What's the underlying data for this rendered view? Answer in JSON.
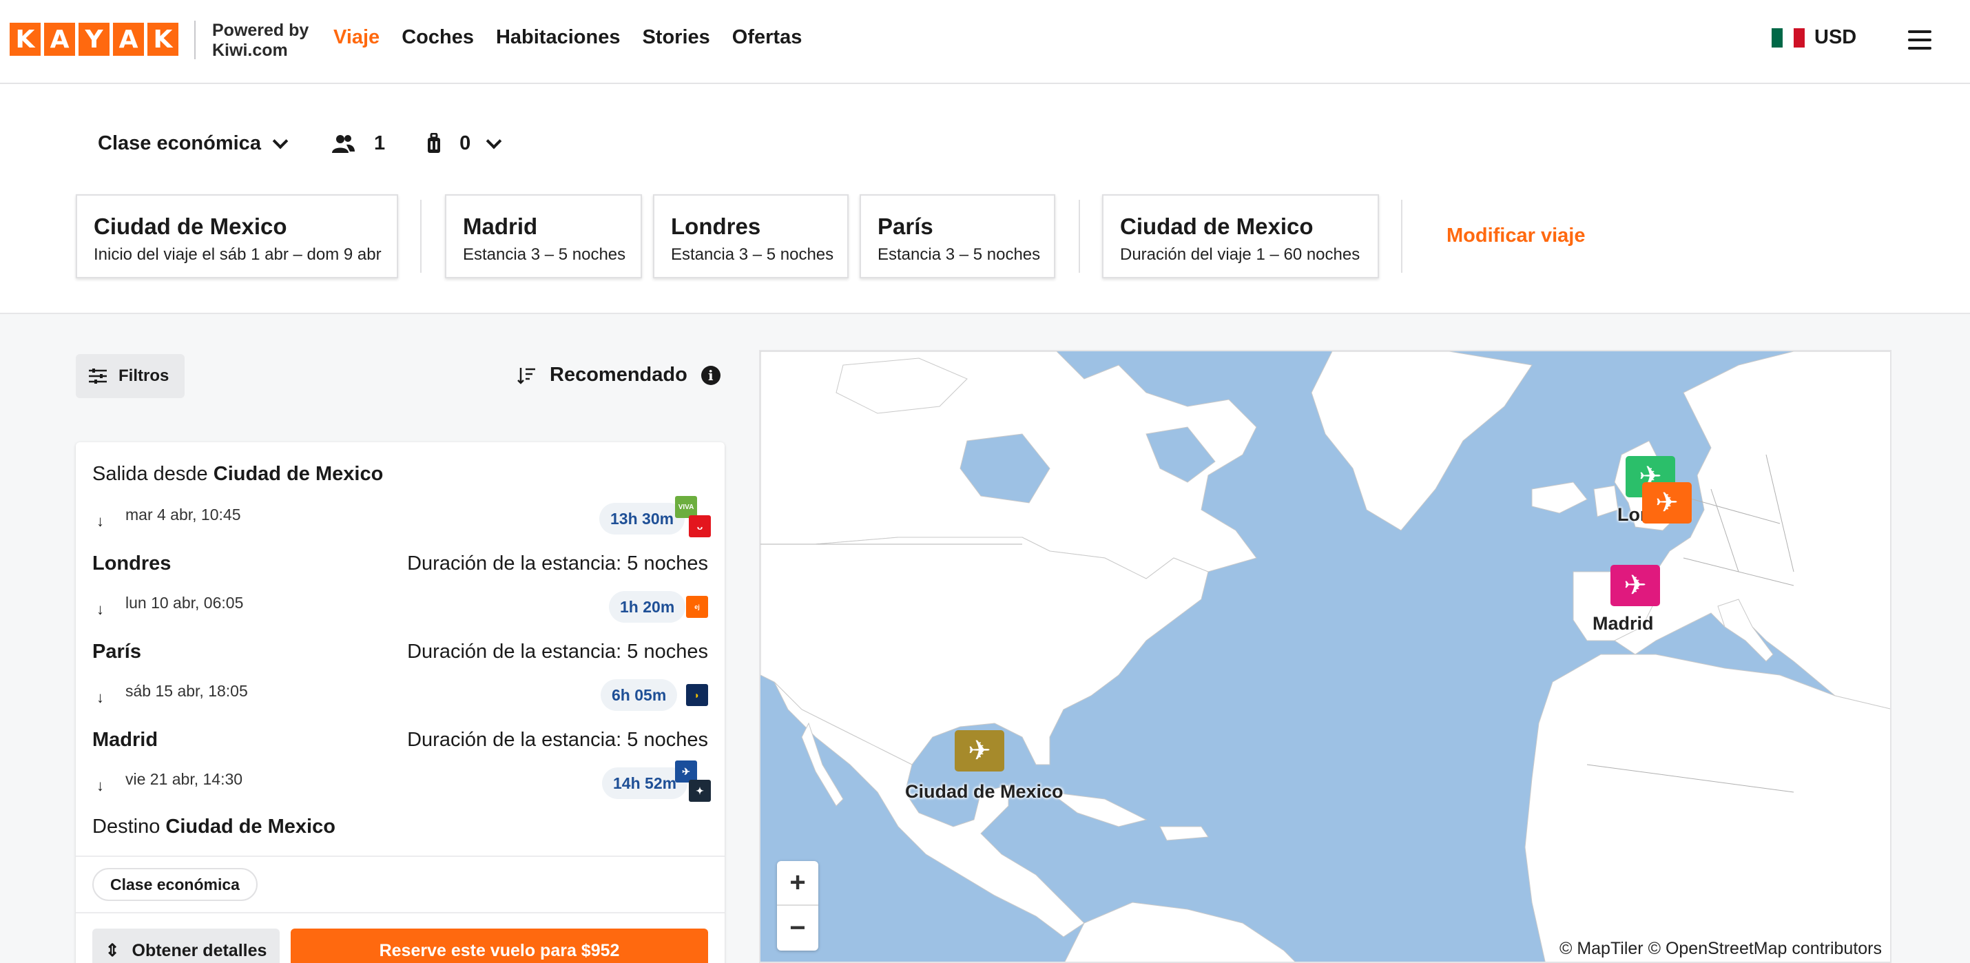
{
  "header": {
    "logo_letters": [
      "K",
      "A",
      "Y",
      "A",
      "K"
    ],
    "powered_line1": "Powered by",
    "powered_line2": "Kiwi.com",
    "nav": [
      {
        "label": "Viaje",
        "active": true
      },
      {
        "label": "Coches",
        "active": false
      },
      {
        "label": "Habitaciones",
        "active": false
      },
      {
        "label": "Stories",
        "active": false
      },
      {
        "label": "Ofertas",
        "active": false
      }
    ],
    "currency": "USD",
    "flag_icon": "mexico-flag-icon",
    "menu_icon": "hamburger-menu-icon"
  },
  "search": {
    "cabin_class": "Clase económica",
    "passengers": "1",
    "bags": "0",
    "legs": [
      {
        "city": "Ciudad de Mexico",
        "detail": "Inicio del viaje el sáb 1 abr – dom 9 abr"
      },
      {
        "city": "Madrid",
        "detail": "Estancia 3 – 5 noches"
      },
      {
        "city": "Londres",
        "detail": "Estancia 3 – 5 noches"
      },
      {
        "city": "París",
        "detail": "Estancia 3 – 5 noches"
      },
      {
        "city": "Ciudad de Mexico",
        "detail": "Duración del viaje 1 – 60 noches"
      }
    ],
    "modify_label": "Modificar viaje"
  },
  "results": {
    "filters_label": "Filtros",
    "sort_label": "Recomendado",
    "card": {
      "departure_prefix": "Salida desde",
      "departure_city": "Ciudad de Mexico",
      "segments": [
        {
          "date": "mar 4 abr, 10:45",
          "duration": "13h 30m"
        },
        {
          "date": "lun 10 abr, 06:05",
          "duration": "1h 20m"
        },
        {
          "date": "sáb 15 abr, 18:05",
          "duration": "6h 05m"
        },
        {
          "date": "vie 21 abr, 14:30",
          "duration": "14h 52m"
        }
      ],
      "stops": [
        {
          "city": "Londres",
          "stay": "Duración de la estancia: 5 noches"
        },
        {
          "city": "París",
          "stay": "Duración de la estancia: 5 noches"
        },
        {
          "city": "Madrid",
          "stay": "Duración de la estancia: 5 noches"
        }
      ],
      "destination_prefix": "Destino",
      "destination_city": "Ciudad de Mexico",
      "cabin_pill": "Clase económica",
      "details_button": "Obtener detalles",
      "book_button": "Reserve este vuelo para $952"
    }
  },
  "map": {
    "labels": {
      "mexico": "Ciudad de Mexico",
      "madrid": "Madrid",
      "london": "Londres"
    },
    "zoom_in": "+",
    "zoom_out": "−",
    "attribution": "© MapTiler © OpenStreetMap contributors",
    "pin_colors": {
      "mexico": "#a68a2b",
      "madrid": "#e0197e",
      "london": "#2bbf6a",
      "paris": "#ff690f"
    }
  }
}
